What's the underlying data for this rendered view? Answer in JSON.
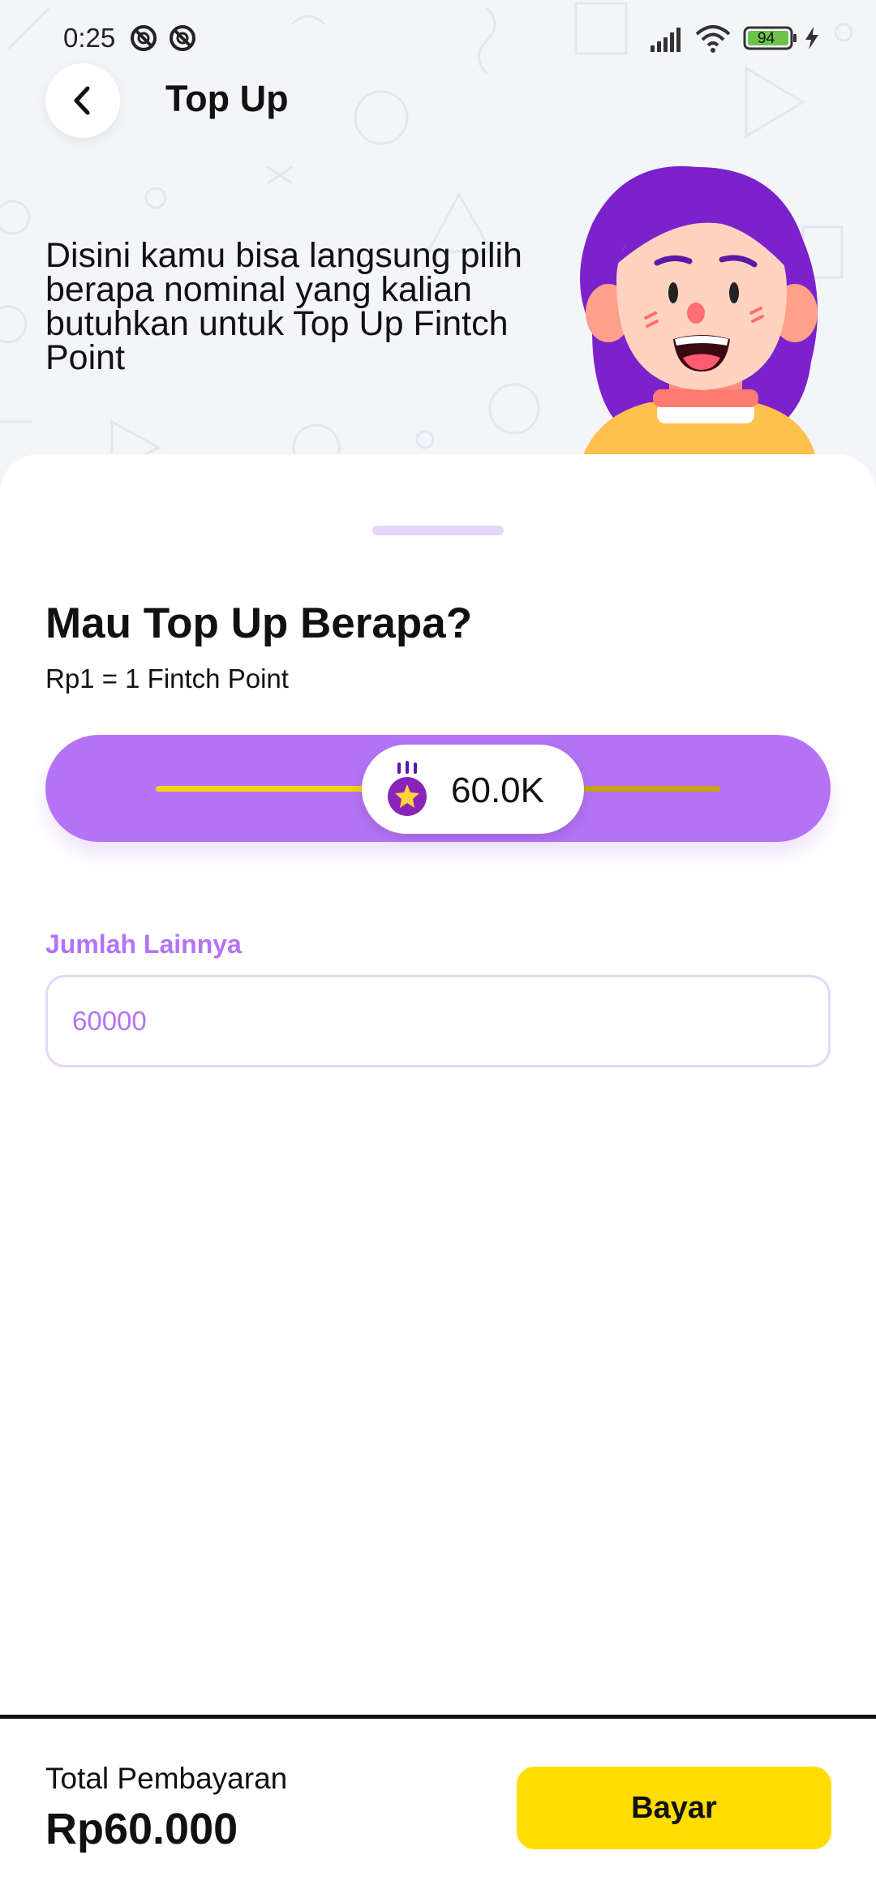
{
  "status_bar": {
    "time": "0:25",
    "battery": "94"
  },
  "header": {
    "title": "Top Up",
    "back_icon": "chevron-left-icon"
  },
  "hero": {
    "description": "Disini kamu bisa langsung pilih berapa nominal yang kalian butuhkan untuk Top Up Fintch Point",
    "illustration": "cartoon-girl"
  },
  "topup": {
    "title": "Mau Top Up Berapa?",
    "rate_text": "Rp1 = 1 Fintch Point",
    "slider_value": "60.0K",
    "slider_icon": "star-coin-icon",
    "other_amount_label": "Jumlah Lainnya",
    "other_amount_value": "60000"
  },
  "footer": {
    "total_label": "Total Pembayaran",
    "total_value": "Rp60.000",
    "pay_button": "Bayar"
  },
  "colors": {
    "accent_purple": "#b473f7",
    "button_yellow": "#ffdd00",
    "background": "#f3f5f9"
  }
}
